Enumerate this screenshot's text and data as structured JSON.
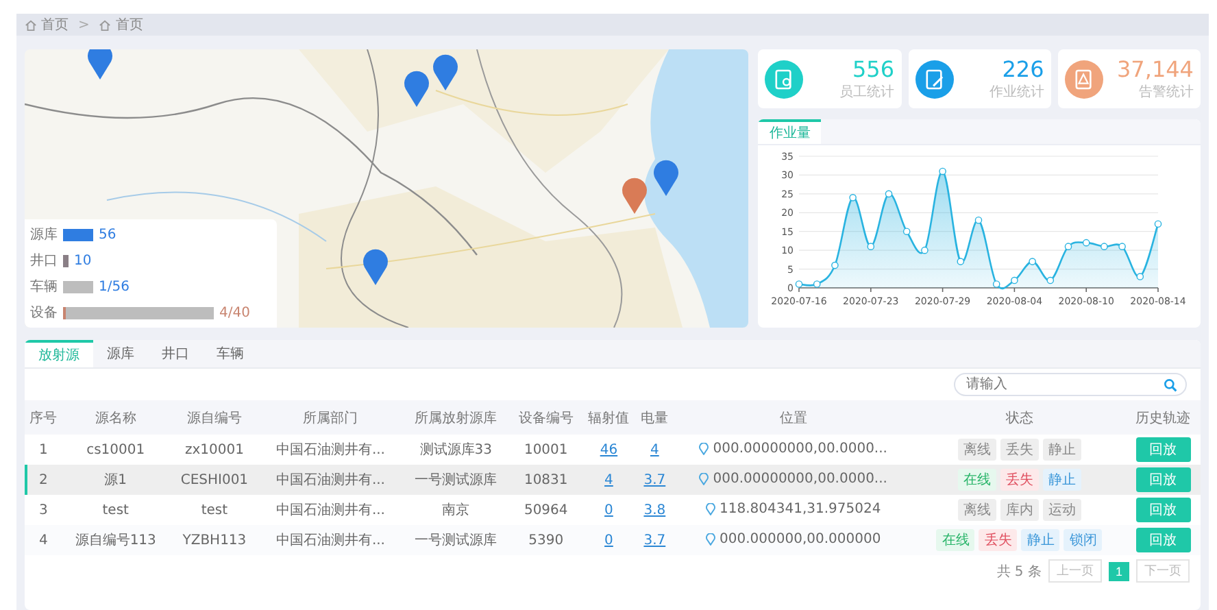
{
  "breadcrumb": [
    {
      "label": "首页"
    },
    {
      "label": "首页"
    }
  ],
  "breadcrumb_separator": ">",
  "map": {
    "legend": [
      {
        "label": "源库",
        "kind": "swatch",
        "color": "#2f7de1",
        "value": "56"
      },
      {
        "label": "井口",
        "kind": "swatch",
        "color": "#8a7f86",
        "value": "10"
      },
      {
        "label": "车辆",
        "kind": "swatch",
        "color": "#bdbdbd",
        "value": "1/56"
      },
      {
        "label": "设备",
        "kind": "meter",
        "color": "#bdbdbd",
        "level": 0.02,
        "value": "4/40"
      }
    ]
  },
  "stats": [
    {
      "value": "556",
      "label": "员工统计",
      "kind": "staff"
    },
    {
      "value": "226",
      "label": "作业统计",
      "kind": "work"
    },
    {
      "value": "37,144",
      "label": "告警统计",
      "kind": "alarm"
    }
  ],
  "chart_tabs": [
    {
      "label": "作业量",
      "selected": true
    }
  ],
  "chart_data": {
    "type": "area",
    "categories": [
      "2020-07-16",
      null,
      null,
      null,
      "2020-07-23",
      null,
      null,
      null,
      "2020-07-29",
      null,
      null,
      null,
      "2020-08-04",
      null,
      null,
      null,
      "2020-08-10",
      null,
      null,
      null,
      "2020-08-14"
    ],
    "series": [
      {
        "color": "#29b3e0",
        "values": [
          1,
          1,
          6,
          24,
          11,
          25,
          15,
          10,
          31,
          7,
          18,
          1,
          2,
          7,
          2,
          11,
          12,
          11,
          11,
          3,
          17
        ]
      }
    ],
    "grid": true,
    "ylim": [
      0,
      35
    ],
    "yticks": [
      0,
      5,
      10,
      15,
      20,
      25,
      30,
      35
    ]
  },
  "tabs": [
    {
      "label": "放射源",
      "selected": true
    },
    {
      "label": "源库",
      "selected": false
    },
    {
      "label": "井口",
      "selected": false
    },
    {
      "label": "车辆",
      "selected": false
    }
  ],
  "search": {
    "placeholder": "请输入"
  },
  "table": {
    "columns": [
      "序号",
      "源名称",
      "源自编号",
      "所属部门",
      "所属放射源库",
      "设备编号",
      "辐射值",
      "电量",
      "位置",
      "状态",
      "历史轨迹"
    ],
    "rows": [
      {
        "selected": false,
        "cells": [
          "1",
          "cs10001",
          "zx10001",
          "中国石油测井有...",
          "测试源库33",
          "10001"
        ],
        "radiation": "46",
        "battery": "4",
        "location": "000.00000000,00.0000...",
        "tags": [
          {
            "label": "离线",
            "kind": "muted"
          },
          {
            "label": "丢失",
            "kind": "muted"
          },
          {
            "label": "静止",
            "kind": "muted"
          }
        ],
        "action": "回放"
      },
      {
        "selected": true,
        "cells": [
          "2",
          "源1",
          "CESHI001",
          "中国石油测井有...",
          "一号测试源库",
          "10831"
        ],
        "radiation": "4",
        "battery": "3.7",
        "location": "000.00000000,00.0000...",
        "tags": [
          {
            "label": "在线",
            "kind": "ok"
          },
          {
            "label": "丢失",
            "kind": "alert"
          },
          {
            "label": "静止",
            "kind": "info"
          }
        ],
        "action": "回放"
      },
      {
        "selected": false,
        "cells": [
          "3",
          "test",
          "test",
          "中国石油测井有...",
          "南京",
          "50964"
        ],
        "radiation": "0",
        "battery": "3.8",
        "location": "118.804341,31.975024",
        "tags": [
          {
            "label": "离线",
            "kind": "muted"
          },
          {
            "label": "库内",
            "kind": "muted"
          },
          {
            "label": "运动",
            "kind": "muted"
          }
        ],
        "action": "回放"
      },
      {
        "selected": false,
        "cells": [
          "4",
          "源自编号113",
          "YZBH113",
          "中国石油测井有...",
          "一号测试源库",
          "5390"
        ],
        "radiation": "0",
        "battery": "3.7",
        "location": "000.000000,00.000000",
        "tags": [
          {
            "label": "在线",
            "kind": "ok"
          },
          {
            "label": "丢失",
            "kind": "alert"
          },
          {
            "label": "静止",
            "kind": "info"
          },
          {
            "label": "锁闭",
            "kind": "info"
          }
        ],
        "action": "回放"
      }
    ]
  },
  "pagination": {
    "total": "共 5 条",
    "prev": "上一页",
    "pages": [
      {
        "label": "1",
        "selected": true
      }
    ],
    "next": "下一页"
  }
}
